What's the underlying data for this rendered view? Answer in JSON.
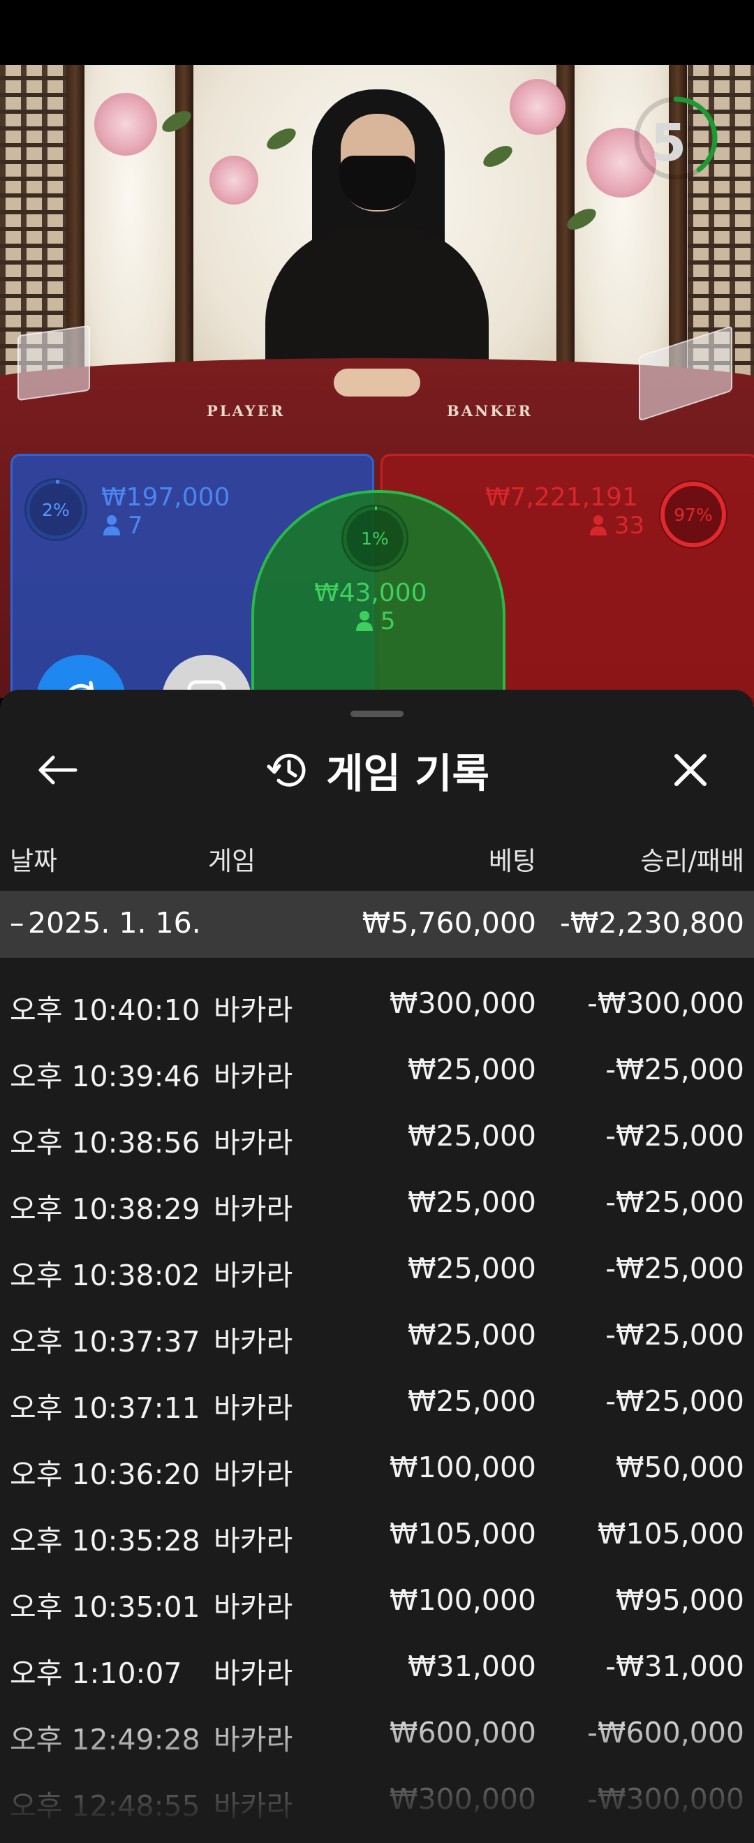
{
  "video": {
    "countdown": "5",
    "table_labels": {
      "player": "PLAYER",
      "banker": "BANKER"
    },
    "player": {
      "percent": "2%",
      "amount": "₩197,000",
      "count": "7",
      "color": "#2b64d6"
    },
    "tie": {
      "percent": "1%",
      "amount": "₩43,000",
      "count": "5",
      "color": "#2bb84a"
    },
    "banker": {
      "percent": "97%",
      "amount": "₩7,221,191",
      "count": "33",
      "color": "#c22024"
    }
  },
  "fabs": [
    {
      "icon": "play-switch-icon",
      "color": "#1e88f0"
    },
    {
      "icon": "stop-square-icon",
      "color": "#d6d6d6"
    }
  ],
  "sheet": {
    "title": "게임 기록",
    "back_icon": "arrow-left-icon",
    "history_icon": "history-clock-icon",
    "close_icon": "close-icon",
    "columns": {
      "date": "날짜",
      "game": "게임",
      "bet": "베팅",
      "result": "승리/패배"
    },
    "summary": {
      "toggle": "–",
      "date": "2025. 1. 16.",
      "bet": "₩5,760,000",
      "result": "-₩2,230,800"
    },
    "rows": [
      {
        "time": "오후 10:40:10",
        "game": "바카라",
        "bet": "₩300,000",
        "result": "-₩300,000"
      },
      {
        "time": "오후 10:39:46",
        "game": "바카라",
        "bet": "₩25,000",
        "result": "-₩25,000"
      },
      {
        "time": "오후 10:38:56",
        "game": "바카라",
        "bet": "₩25,000",
        "result": "-₩25,000"
      },
      {
        "time": "오후 10:38:29",
        "game": "바카라",
        "bet": "₩25,000",
        "result": "-₩25,000"
      },
      {
        "time": "오후 10:38:02",
        "game": "바카라",
        "bet": "₩25,000",
        "result": "-₩25,000"
      },
      {
        "time": "오후 10:37:37",
        "game": "바카라",
        "bet": "₩25,000",
        "result": "-₩25,000"
      },
      {
        "time": "오후 10:37:11",
        "game": "바카라",
        "bet": "₩25,000",
        "result": "-₩25,000"
      },
      {
        "time": "오후 10:36:20",
        "game": "바카라",
        "bet": "₩100,000",
        "result": "₩50,000"
      },
      {
        "time": "오후 10:35:28",
        "game": "바카라",
        "bet": "₩105,000",
        "result": "₩105,000"
      },
      {
        "time": "오후 10:35:01",
        "game": "바카라",
        "bet": "₩100,000",
        "result": "₩95,000"
      },
      {
        "time": "오후 1:10:07",
        "game": "바카라",
        "bet": "₩31,000",
        "result": "-₩31,000"
      },
      {
        "time": "오후 12:49:28",
        "game": "바카라",
        "bet": "₩600,000",
        "result": "-₩600,000"
      },
      {
        "time": "오후 12:48:55",
        "game": "바카라",
        "bet": "₩300,000",
        "result": "-₩300,000"
      }
    ]
  }
}
